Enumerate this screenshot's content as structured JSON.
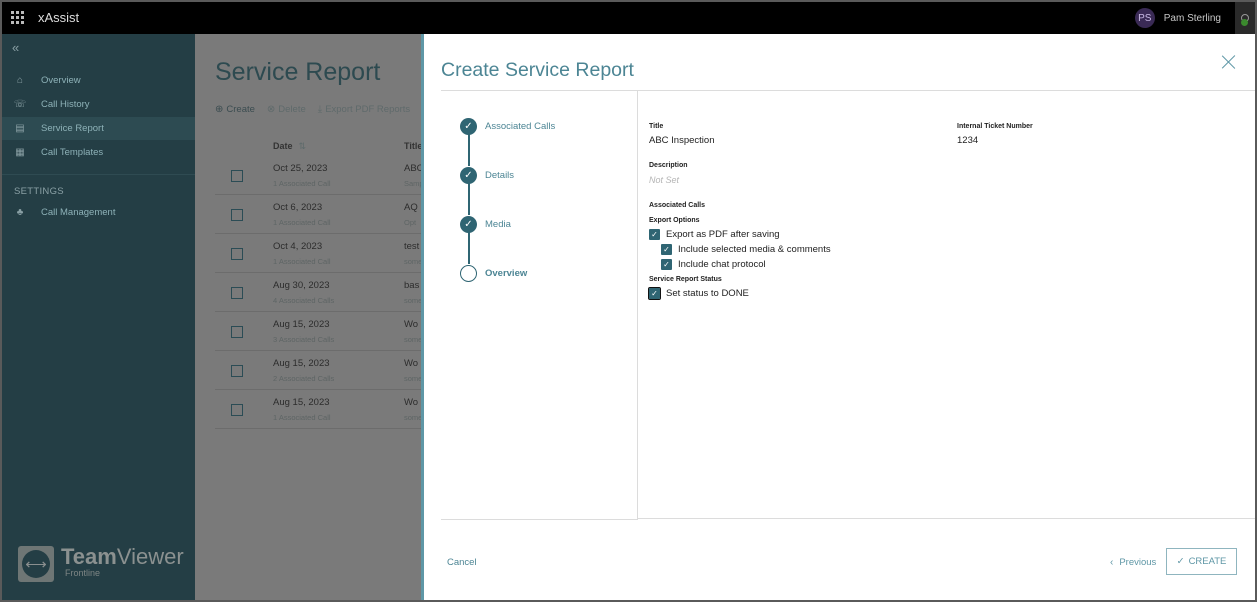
{
  "app": {
    "title": "xAssist",
    "user": {
      "initials": "PS",
      "name": "Pam Sterling"
    }
  },
  "sidebar": {
    "items": [
      {
        "label": "Overview",
        "icon": "home-icon",
        "glyph": "⌂"
      },
      {
        "label": "Call History",
        "icon": "call-history-icon",
        "glyph": "☏"
      },
      {
        "label": "Service Report",
        "icon": "document-icon",
        "glyph": "▤",
        "active": true
      },
      {
        "label": "Call Templates",
        "icon": "template-icon",
        "glyph": "▦"
      }
    ],
    "settings_heading": "SETTINGS",
    "settings_items": [
      {
        "label": "Call Management",
        "icon": "org-chart-icon",
        "glyph": "♣"
      }
    ],
    "logo": {
      "brand_bold": "Team",
      "brand_light": "Viewer",
      "sub": "Frontline"
    }
  },
  "page": {
    "title": "Service Report",
    "toolbar": {
      "create": "Create",
      "delete": "Delete",
      "export": "Export PDF Reports"
    },
    "columns": {
      "date": "Date",
      "title": "Title"
    },
    "rows": [
      {
        "date": "Oct 25, 2023",
        "sub": "1 Associated Call",
        "title": "ABC Inspection",
        "title_sub": "Sample"
      },
      {
        "date": "Oct 6, 2023",
        "sub": "1 Associated Call",
        "title": "AQ",
        "title_sub": "Opt"
      },
      {
        "date": "Oct 4, 2023",
        "sub": "1 Associated Call",
        "title": "test",
        "title_sub": "some"
      },
      {
        "date": "Aug 30, 2023",
        "sub": "4 Associated Calls",
        "title": "bas",
        "title_sub": "some"
      },
      {
        "date": "Aug 15, 2023",
        "sub": "3 Associated Calls",
        "title": "Wo",
        "title_sub": "some"
      },
      {
        "date": "Aug 15, 2023",
        "sub": "2 Associated Calls",
        "title": "Wo",
        "title_sub": "some"
      },
      {
        "date": "Aug 15, 2023",
        "sub": "1 Associated Call",
        "title": "Wo",
        "title_sub": "some"
      }
    ]
  },
  "modal": {
    "title": "Create Service Report",
    "steps": [
      {
        "label": "Associated Calls",
        "done": true
      },
      {
        "label": "Details",
        "done": true
      },
      {
        "label": "Media",
        "done": true
      },
      {
        "label": "Overview",
        "done": false,
        "current": true
      }
    ],
    "overview": {
      "title_label": "Title",
      "title_value": "ABC Inspection",
      "ticket_label": "Internal Ticket Number",
      "ticket_value": "1234",
      "description_label": "Description",
      "description_value": "Not Set",
      "associated_calls_label": "Associated Calls",
      "export_options_label": "Export Options",
      "export_pdf": {
        "label": "Export as PDF after saving",
        "checked": true
      },
      "include_media": {
        "label": "Include selected media & comments",
        "checked": true
      },
      "include_chat": {
        "label": "Include chat protocol",
        "checked": true
      },
      "status_label": "Service Report Status",
      "set_done": {
        "label": "Set status to DONE",
        "checked": true
      }
    },
    "footer": {
      "cancel": "Cancel",
      "previous": "Previous",
      "create": "CREATE"
    }
  }
}
